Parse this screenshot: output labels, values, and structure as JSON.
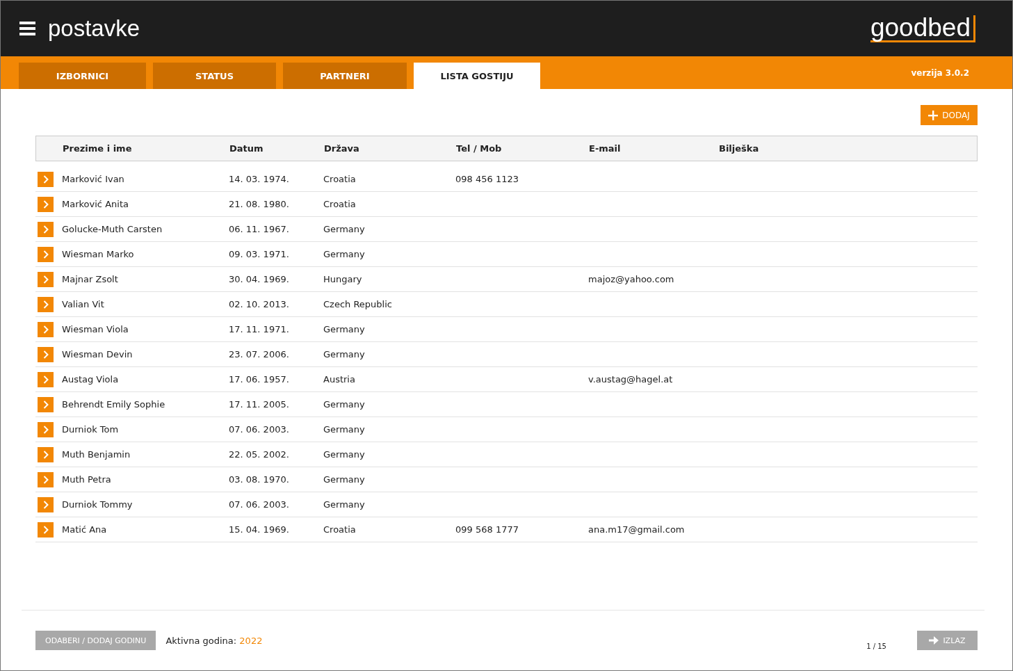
{
  "header": {
    "title": "postavke",
    "logo": "goodbed"
  },
  "tabs": [
    {
      "label": "IZBORNICI",
      "selected": false
    },
    {
      "label": "STATUS",
      "selected": false
    },
    {
      "label": "PARTNERI",
      "selected": false
    },
    {
      "label": "LISTA GOSTIJU",
      "selected": true
    }
  ],
  "version": "verzija 3.0.2",
  "add_button": "DODAJ",
  "table": {
    "columns": [
      "Prezime i ime",
      "Datum",
      "Država",
      "Tel / Mob",
      "E-mail",
      "Bilješka"
    ],
    "rows": [
      {
        "name": "Marković Ivan",
        "date": "14. 03. 1974.",
        "country": "Croatia",
        "phone": "098 456 1123",
        "email": ""
      },
      {
        "name": "Marković Anita",
        "date": "21. 08. 1980.",
        "country": "Croatia",
        "phone": "",
        "email": ""
      },
      {
        "name": "Golucke-Muth Carsten",
        "date": "06. 11. 1967.",
        "country": "Germany",
        "phone": "",
        "email": ""
      },
      {
        "name": "Wiesman Marko",
        "date": "09. 03. 1971.",
        "country": "Germany",
        "phone": "",
        "email": ""
      },
      {
        "name": "Majnar Zsolt",
        "date": "30. 04. 1969.",
        "country": "Hungary",
        "phone": "",
        "email": "majoz@yahoo.com"
      },
      {
        "name": "Valian Vit",
        "date": "02. 10. 2013.",
        "country": "Czech Republic",
        "phone": "",
        "email": ""
      },
      {
        "name": "Wiesman Viola",
        "date": "17. 11. 1971.",
        "country": "Germany",
        "phone": "",
        "email": ""
      },
      {
        "name": "Wiesman Devin",
        "date": "23. 07. 2006.",
        "country": "Germany",
        "phone": "",
        "email": ""
      },
      {
        "name": "Austag Viola",
        "date": "17. 06. 1957.",
        "country": "Austria",
        "phone": "",
        "email": "v.austag@hagel.at"
      },
      {
        "name": "Behrendt Emily Sophie",
        "date": "17. 11. 2005.",
        "country": "Germany",
        "phone": "",
        "email": ""
      },
      {
        "name": "Durniok Tom",
        "date": "07. 06. 2003.",
        "country": "Germany",
        "phone": "",
        "email": ""
      },
      {
        "name": "Muth Benjamin",
        "date": "22. 05. 2002.",
        "country": "Germany",
        "phone": "",
        "email": ""
      },
      {
        "name": "Muth Petra",
        "date": "03. 08. 1970.",
        "country": "Germany",
        "phone": "",
        "email": ""
      },
      {
        "name": "Durniok Tommy",
        "date": "07. 06. 2003.",
        "country": "Germany",
        "phone": "",
        "email": ""
      },
      {
        "name": "Matić Ana",
        "date": "15. 04. 1969.",
        "country": "Croatia",
        "phone": "099 568 1777",
        "email": "ana.m17@gmail.com"
      }
    ]
  },
  "footer": {
    "year_button": "ODABERI / DODAJ GODINU",
    "year_label": "Aktivna godina:",
    "year_value": "2022",
    "page": "1 / 15",
    "exit_button": "IZLAZ"
  }
}
